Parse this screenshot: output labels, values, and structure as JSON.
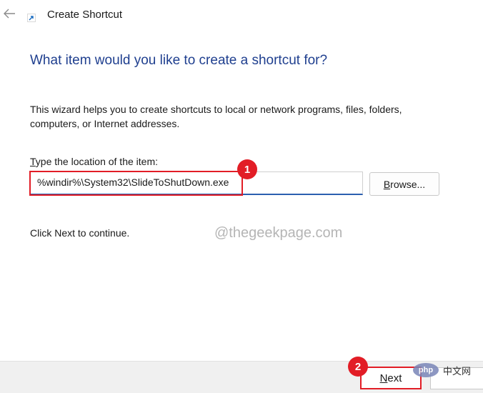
{
  "window": {
    "title": "Create Shortcut",
    "back_icon": "arrow-left-icon",
    "app_icon": "shortcut-icon"
  },
  "main": {
    "heading": "What item would you like to create a shortcut for?",
    "description": "This wizard helps you to create shortcuts to local or network programs, files, folders, computers, or Internet addresses.",
    "location_label_accesskey": "T",
    "location_label_rest": "ype the location of the item:",
    "location_value": "%windir%\\System32\\SlideToShutDown.exe",
    "browse_accesskey": "B",
    "browse_rest": "rowse...",
    "continue_text": "Click Next to continue."
  },
  "footer": {
    "next_accesskey": "N",
    "next_rest": "ext"
  },
  "annotations": {
    "step1": "1",
    "step2": "2",
    "color": "#e21d26"
  },
  "overlay": {
    "watermark": "@thegeekpage.com",
    "php_logo": "php",
    "php_site": "中文网"
  },
  "colors": {
    "heading": "#1f3f8f",
    "input_focus_border": "#2b5fb0",
    "footer_bg": "#f0f0f0"
  }
}
